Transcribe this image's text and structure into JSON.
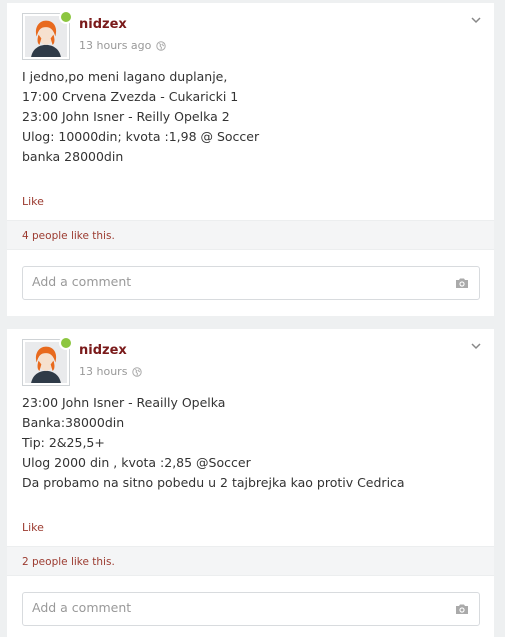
{
  "posts": [
    {
      "author": "nidzex",
      "time": "13 hours ago",
      "lines": [
        "I jedno,po meni lagano duplanje,",
        "17:00 Crvena Zvezda - Cukaricki 1",
        "23:00 John Isner - Reilly Opelka 2",
        "Ulog: 10000din; kvota :1,98 @ Soccer",
        "banka 28000din"
      ],
      "like_label": "Like",
      "likes_text": "4 people like this.",
      "comment_placeholder": "Add a comment"
    },
    {
      "author": "nidzex",
      "time": "13 hours",
      "lines": [
        "23:00 John Isner - Reailly Opelka",
        "Banka:38000din",
        "Tip: 2&25,5+",
        "Ulog 2000 din , kvota :2,85 @Soccer",
        "Da probamo na sitno pobedu u 2 tajbrejka kao protiv Cedrica"
      ],
      "like_label": "Like",
      "likes_text": "2 people like this.",
      "comment_placeholder": "Add a comment"
    }
  ],
  "icons": {
    "online_status": "online-dot",
    "privacy": "globe-icon",
    "menu": "chevron-down-icon",
    "attach": "camera-icon"
  },
  "colors": {
    "author": "#7a1a1a",
    "link": "#9b3a2f",
    "online": "#8cc63f",
    "background": "#eef0f1"
  }
}
